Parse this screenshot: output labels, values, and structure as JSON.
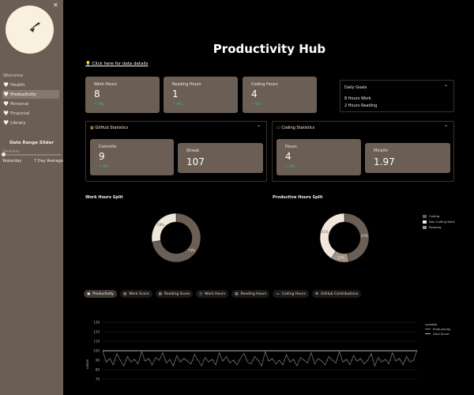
{
  "sidebar": {
    "welcome": "Welcome",
    "items": [
      {
        "label": "Health",
        "active": false
      },
      {
        "label": "Productivity",
        "active": true
      },
      {
        "label": "Personal",
        "active": false
      },
      {
        "label": "Financial",
        "active": false
      },
      {
        "label": "Library",
        "active": false
      }
    ],
    "date_range": {
      "title": "Date Range Slider",
      "slider_label": "Timeframe",
      "left_label": "Yesterday",
      "right_label": "7 Day Average"
    }
  },
  "header": {
    "title": "Productivity Hub",
    "data_link": "Click here for data details"
  },
  "metrics": [
    {
      "label": "Work Hours",
      "value": "8",
      "delta": "↑ 0%"
    },
    {
      "label": "Reading Hours",
      "value": "1",
      "delta": "↑ 0%"
    },
    {
      "label": "Coding Hours",
      "value": "4",
      "delta": "↑ 0%"
    }
  ],
  "daily_goals": {
    "title": "Daily Goals",
    "lines": [
      "8 Hours Work",
      "2 Hours Reading"
    ]
  },
  "github": {
    "title": "GitHub Statistics",
    "cards": [
      {
        "label": "Commits",
        "value": "9",
        "delta": "↑ 0%"
      },
      {
        "label": "Streak",
        "value": "107",
        "delta": ""
      }
    ]
  },
  "coding": {
    "title": "Coding Statistics",
    "cards": [
      {
        "label": "Hours",
        "value": "4",
        "delta": "↑ 0%"
      },
      {
        "label": "Mins/hr",
        "value": "1.97",
        "delta": ""
      }
    ]
  },
  "chart_data": [
    {
      "type": "pie",
      "title": "Work Hours Split",
      "donut": true,
      "slices": [
        {
          "value": 73,
          "label": "73%",
          "color": "#6b5e55"
        },
        {
          "value": 28,
          "label": "28%",
          "color": "#efe6dc"
        }
      ]
    },
    {
      "type": "pie",
      "title": "Productive Hours Split",
      "donut": true,
      "legend": [
        "Coding",
        "Non Coding Work",
        "Reading"
      ],
      "legend_position": "right",
      "slices": [
        {
          "value": 47,
          "label": "47%",
          "color": "#6b5e55",
          "name": "Coding"
        },
        {
          "value": 12,
          "label": "12%",
          "color": "#a09488",
          "name": "Reading"
        },
        {
          "value": 41,
          "label": "41%",
          "color": "#efe6dc",
          "name": "Non Coding Work"
        }
      ]
    },
    {
      "type": "line",
      "ylabel": "value",
      "legend_title": "variable",
      "legend": [
        "Productivity",
        "Goal Score"
      ],
      "ylim": [
        70,
        130
      ],
      "yticks": [
        70,
        80,
        90,
        100,
        110,
        120,
        130
      ],
      "grid": true,
      "series": [
        {
          "name": "Goal Score",
          "color": "#bdb3a8",
          "values": [
            100,
            100,
            100,
            100,
            100,
            100,
            100,
            100,
            100,
            100,
            100,
            100,
            100,
            100,
            100,
            100,
            100,
            100,
            100,
            100,
            100,
            100,
            100,
            100,
            100,
            100,
            100,
            100,
            100,
            100,
            100,
            100,
            100,
            100,
            100,
            100,
            100,
            100,
            100,
            100,
            100,
            100,
            100,
            100,
            100,
            100,
            100,
            100,
            100,
            100,
            100,
            100,
            100,
            100,
            100,
            100,
            100,
            100,
            100,
            100,
            100,
            100,
            100,
            100,
            100,
            100,
            100,
            100,
            100,
            100,
            100,
            100,
            100,
            100,
            100,
            100,
            100,
            100,
            100,
            100,
            100,
            100,
            100,
            100,
            100,
            100,
            100,
            100,
            100,
            100
          ]
        },
        {
          "name": "Productivity",
          "color": "#8a8178",
          "values": [
            100,
            88,
            92,
            85,
            97,
            90,
            84,
            94,
            88,
            91,
            86,
            99,
            89,
            92,
            85,
            93,
            90,
            98,
            87,
            91,
            84,
            95,
            88,
            92,
            89,
            86,
            96,
            90,
            84,
            93,
            88,
            91,
            85,
            98,
            89,
            94,
            87,
            90,
            85,
            92,
            97,
            88,
            86,
            94,
            90,
            84,
            99,
            89,
            92,
            86,
            90,
            85,
            96,
            88,
            91,
            84,
            93,
            90,
            87,
            98,
            86,
            92,
            89,
            85,
            94,
            90,
            87,
            99,
            88,
            91,
            85,
            95,
            89,
            92,
            86,
            90,
            97,
            84,
            93,
            88,
            91,
            86,
            98,
            89,
            92,
            85,
            94,
            88,
            90,
            101
          ]
        }
      ]
    }
  ],
  "tabs": [
    {
      "label": "Productivity",
      "icon": "briefcase-icon",
      "active": true
    },
    {
      "label": "Work Score",
      "icon": "chart-icon",
      "active": false
    },
    {
      "label": "Reading Score",
      "icon": "book-icon",
      "active": false
    },
    {
      "label": "Work Hours",
      "icon": "clock-icon",
      "active": false
    },
    {
      "label": "Reading Hours",
      "icon": "book-icon",
      "active": false
    },
    {
      "label": "Coding Hours",
      "icon": "laptop-icon",
      "active": false
    },
    {
      "label": "GitHub Contributions",
      "icon": "gear-icon",
      "active": false
    }
  ],
  "colors": {
    "sidebar": "#6b5e55",
    "card": "#6b5e55",
    "delta_up": "#39c56a",
    "logo_bg": "#f9f0de"
  }
}
